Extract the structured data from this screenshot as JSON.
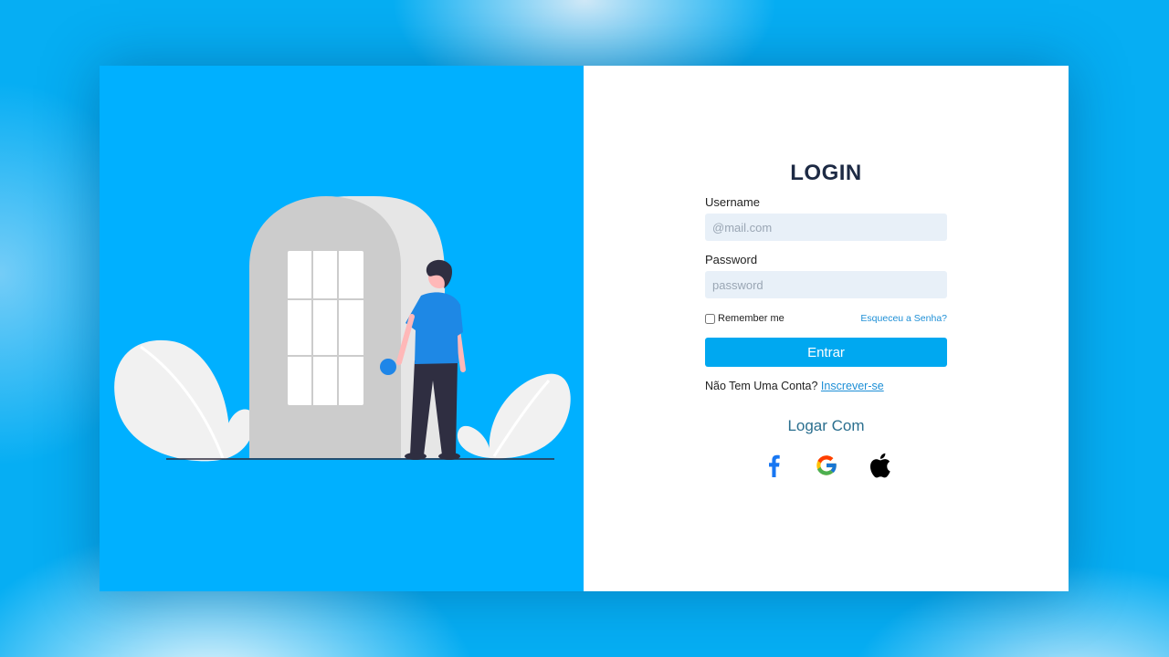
{
  "login": {
    "title": "LOGIN",
    "username_label": "Username",
    "username_placeholder": "@mail.com",
    "username_value": "",
    "password_label": "Password",
    "password_placeholder": "password",
    "password_value": "",
    "remember_label": "Remember me",
    "remember_checked": false,
    "forgot_link": "Esqueceu a Senha?",
    "submit_label": "Entrar",
    "signup_prompt": "Não Tem Uma Conta?",
    "signup_link": "Inscrever-se",
    "social_title": "Logar Com",
    "social_icons": [
      "facebook-icon",
      "google-icon",
      "apple-icon"
    ]
  },
  "colors": {
    "background": "#06aef3",
    "left_panel": "#00b0ff",
    "primary_button": "#00a8f0",
    "link": "#1e8fd6",
    "title": "#1d2a44",
    "input_bg": "#e8f0f8"
  }
}
